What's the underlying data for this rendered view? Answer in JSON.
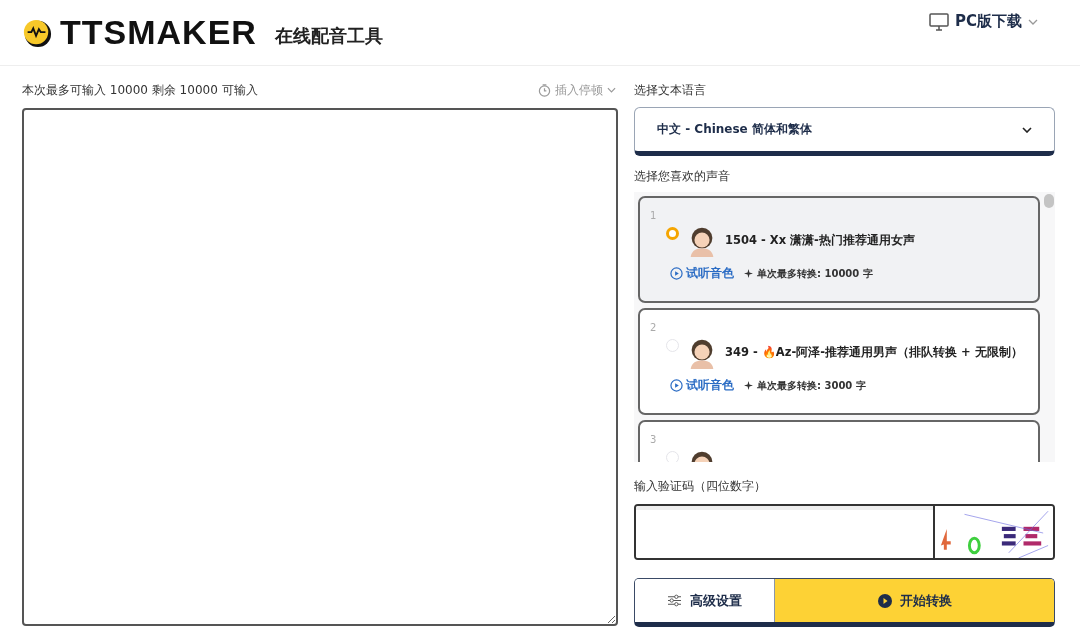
{
  "header": {
    "logo": "TTSMAKER",
    "tagline": "在线配音工具",
    "download": "PC版下载"
  },
  "text_input": {
    "counter": "本次最多可输入 10000 剩余 10000 可输入",
    "insert_pause": "插入停顿"
  },
  "language": {
    "label": "选择文本语言",
    "value": "中文 - Chinese 简体和繁体"
  },
  "voices": {
    "label": "选择您喜欢的声音",
    "items": [
      {
        "index": "1",
        "name": "1504 - Xx 潇潇-热门推荐通用女声",
        "selected": true,
        "preview": "试听音色",
        "limit": "单次最多转换: 10000 字"
      },
      {
        "index": "2",
        "name": "349 - 🔥Az-阿泽-推荐通用男声（排队转换 + 无限制）",
        "selected": false,
        "preview": "试听音色",
        "limit": "单次最多转换: 3000 字"
      },
      {
        "index": "3",
        "selected": false
      }
    ]
  },
  "captcha": {
    "label": "输入验证码（四位数字）"
  },
  "buttons": {
    "advanced": "高级设置",
    "start": "开始转换"
  }
}
